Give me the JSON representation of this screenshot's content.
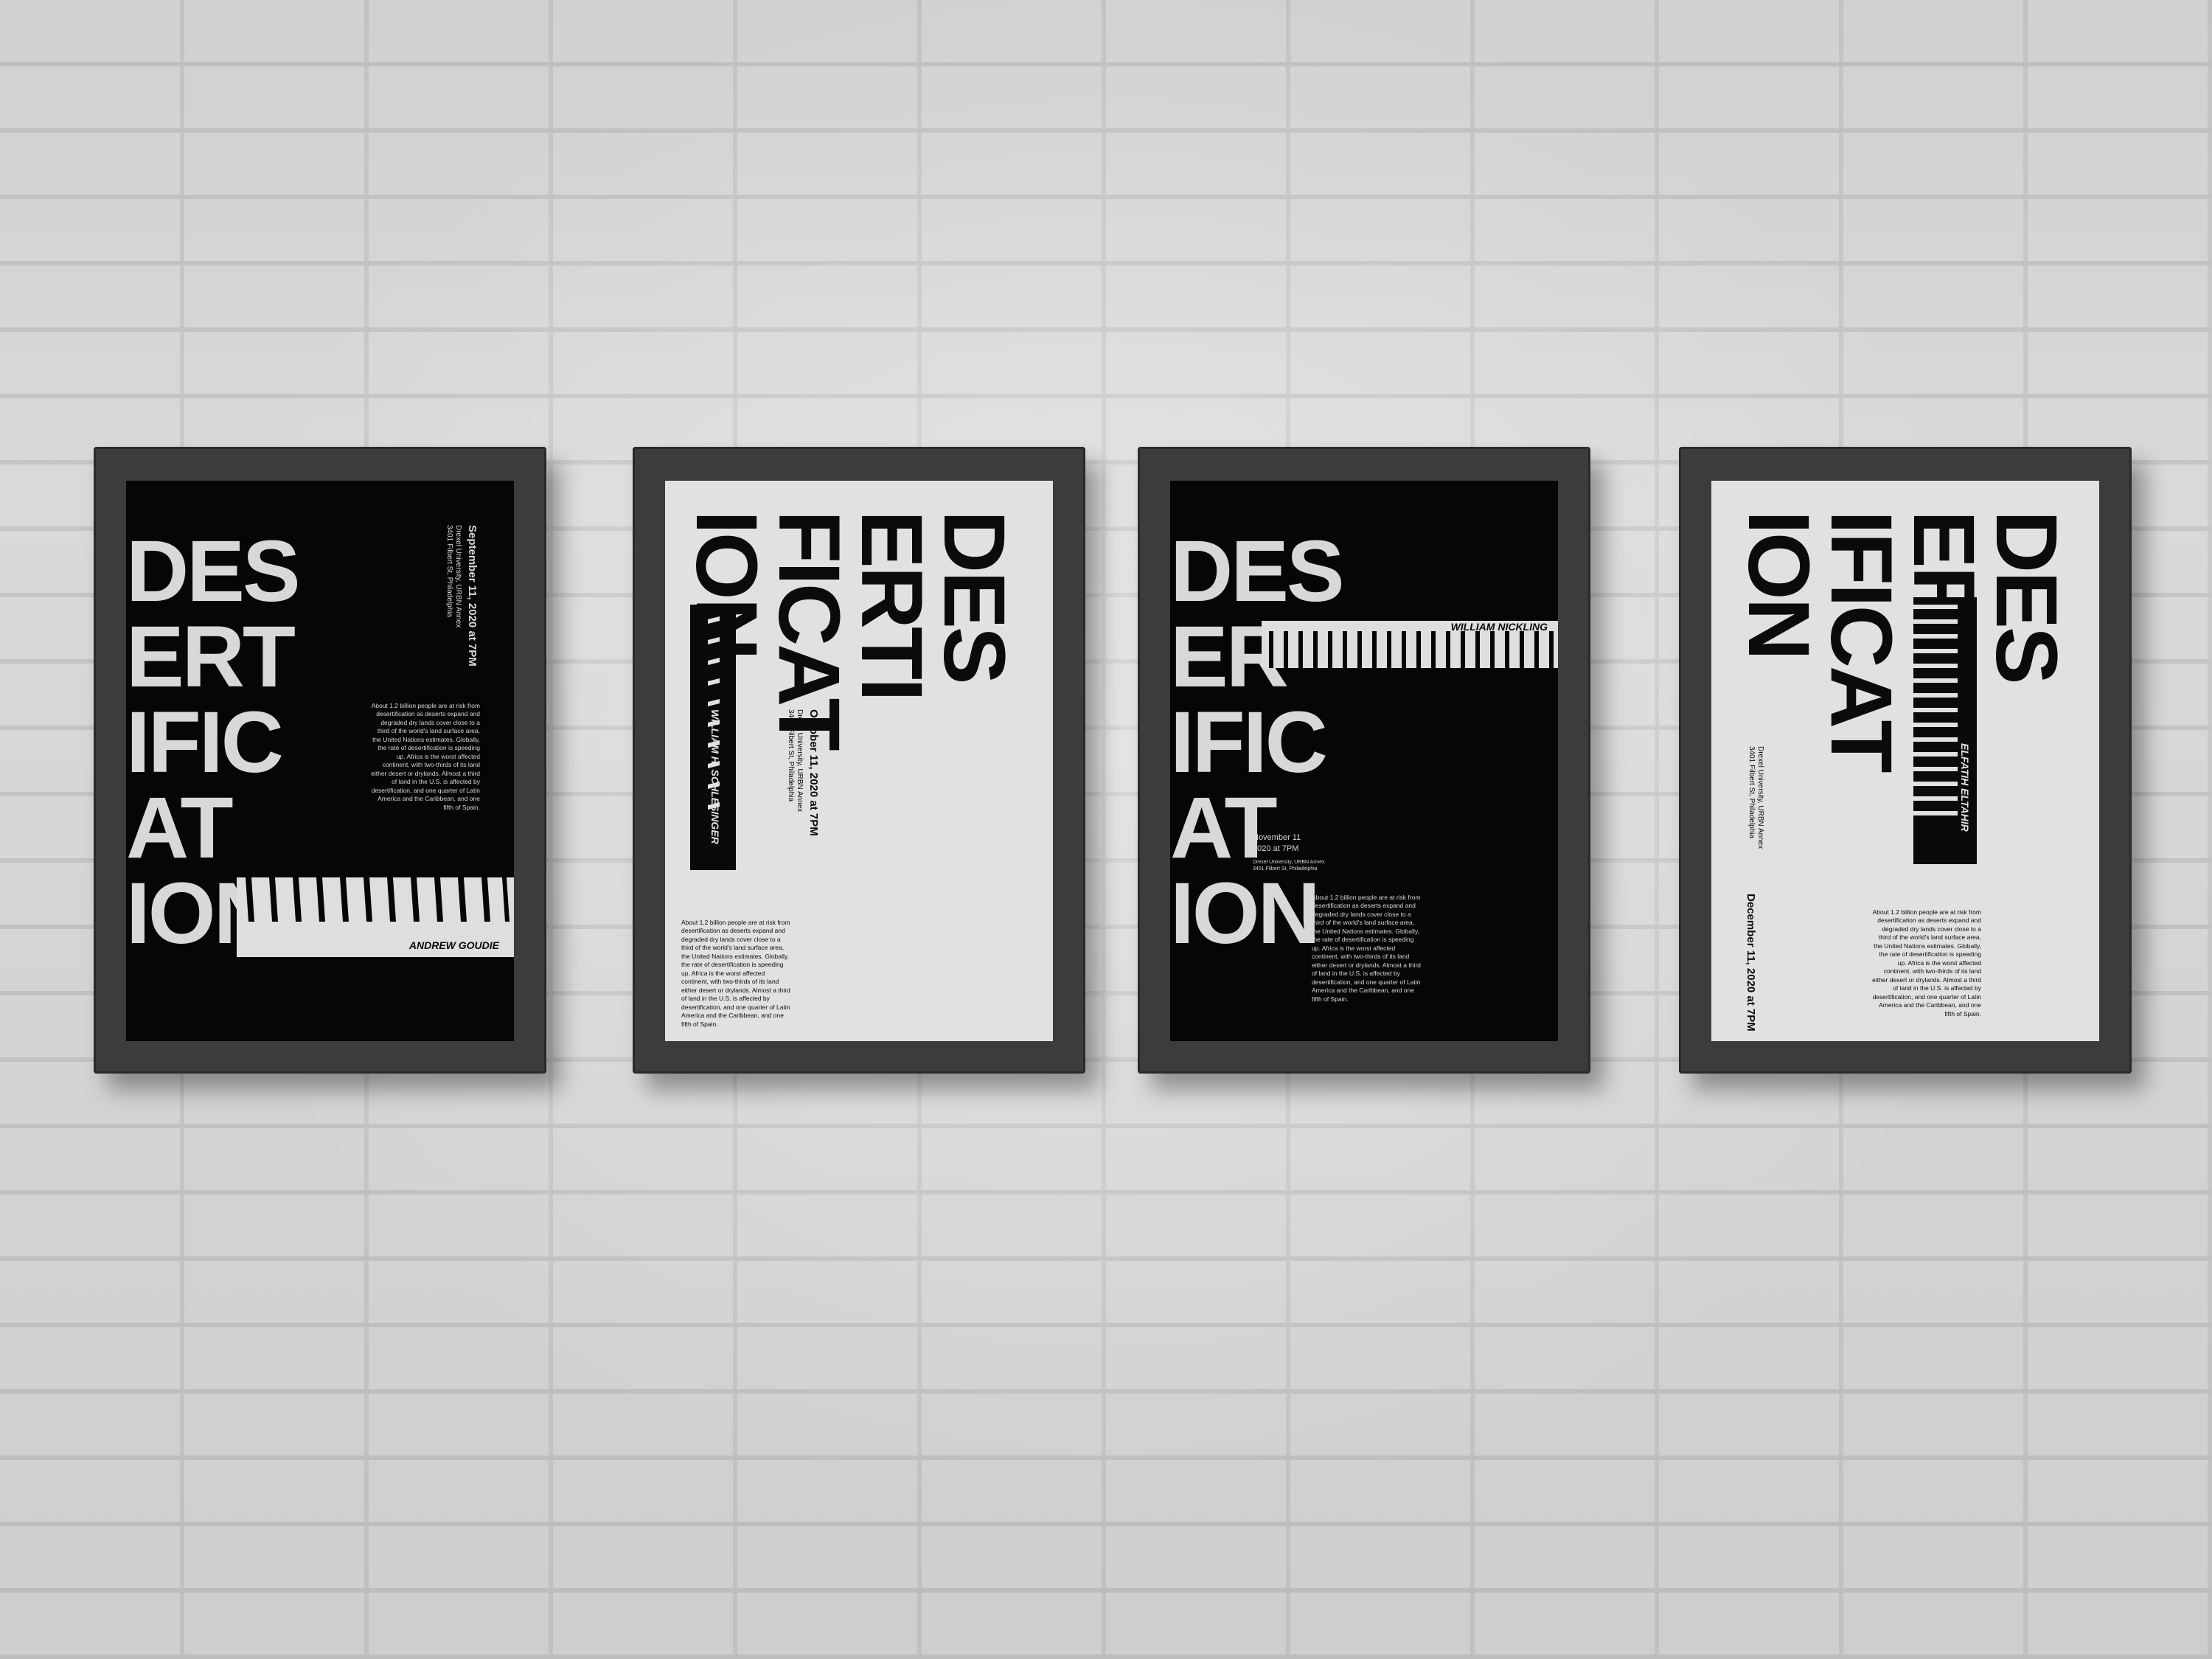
{
  "scene": {
    "wall": "white-brick-wall",
    "colors": {
      "frame": "#3c3c3c",
      "poster_black": "#060606",
      "poster_white": "#e1e1e1"
    }
  },
  "posters": [
    {
      "title_lines": [
        "DES",
        "ERT",
        "IFIC",
        "AT",
        "ION"
      ],
      "date": "September 11, 2020 at 7PM",
      "venue": "Drexel University, URBN Annex",
      "address": "3401 Filbert St, Philadelphia",
      "paragraph": "About 1.2 billion people are at risk from desertification as deserts expand and degraded dry lands cover close to a third of the world's land surface area, the United Nations estimates. Globally, the rate of desertification is speeding up. Africa is the worst affected continent, with two-thirds of its land either desert or drylands. Almost a third of land in the U.S. is affected by desertification, and one quarter of Latin America and the Caribbean, and one fifth of Spain.",
      "speaker": "ANDREW GOUDIE"
    },
    {
      "title_lines": [
        "DES",
        "ERTI",
        "FICAT",
        "ION"
      ],
      "date": "October 11, 2020 at 7PM",
      "venue": "Drexel University, URBN Annex",
      "address": "3401 Filbert St, Philadelphia",
      "paragraph": "About 1.2 billion people are at risk from desertification as deserts expand and degraded dry lands cover close to a third of the world's land surface area, the United Nations estimates. Globally, the rate of desertification is speeding up. Africa is the worst affected continent, with two-thirds of its land either desert or drylands. Almost a third of land in the U.S. is affected by desertification, and one quarter of Latin America and the Caribbean, and one fifth of Spain.",
      "speaker": "WILLIAM H. SCHLESINGER"
    },
    {
      "title_lines": [
        "DES",
        "ER",
        "IFIC",
        "AT",
        "ION"
      ],
      "date_line1": "November 11",
      "date_line2": "2020 at 7PM",
      "venue": "Drexel University, URBN Annex",
      "address": "3401 Filbert St, Philadelphia",
      "paragraph": "About 1.2 billion people are at risk from desertification as deserts expand and degraded dry lands cover close to a third of the world's land surface area, the United Nations estimates. Globally, the rate of desertification is speeding up. Africa is the worst affected continent, with two-thirds of its land either desert or drylands. Almost a third of land in the U.S. is affected by desertification, and one quarter of Latin America and the Caribbean, and one fifth of Spain.",
      "speaker": "WILLIAM NICKLING"
    },
    {
      "title_lines": [
        "DES",
        "ER",
        "IFICAT",
        "ION"
      ],
      "date": "December 11, 2020 at 7PM",
      "venue": "Drexel University, URBN Annex",
      "address": "3401 Filbert St, Philadelphia",
      "paragraph": "About 1.2 billion people are at risk from desertification as deserts expand and degraded dry lands cover close to a third of the world's land surface area, the United Nations estimates. Globally, the rate of desertification is speeding up. Africa is the worst affected continent, with two-thirds of its land either desert or drylands. Almost a third of land in the U.S. is affected by desertification, and one quarter of Latin America and the Caribbean, and one fifth of Spain.",
      "speaker": "ELFATIH ELTAHIR"
    }
  ]
}
